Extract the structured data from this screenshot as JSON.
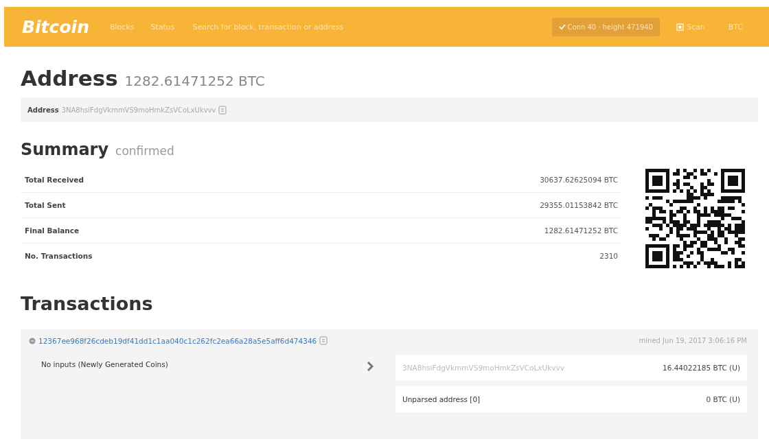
{
  "header": {
    "logo": "Bitcoin",
    "nav": [
      {
        "label": "Blocks"
      },
      {
        "label": "Status"
      }
    ],
    "search": {
      "placeholder": "Search for block, transaction or address"
    },
    "connection": "Conn 40 · height 471940",
    "scan": "Scan",
    "currency": "BTC"
  },
  "address": {
    "title": "Address",
    "balance": "1282.61471252 BTC",
    "label": "Address",
    "value": "3NA8hsiFdgVkmmVS9moHmkZsVCoLxUkvvv"
  },
  "summary": {
    "title": "Summary",
    "status": "confirmed",
    "rows": [
      {
        "label": "Total Received",
        "value": "30637.62625094 BTC"
      },
      {
        "label": "Total Sent",
        "value": "29355.01153842 BTC"
      },
      {
        "label": "Final Balance",
        "value": "1282.61471252 BTC"
      },
      {
        "label": "No. Transactions",
        "value": "2310"
      }
    ]
  },
  "transactions": {
    "title": "Transactions",
    "items": [
      {
        "hash": "12367ee968f26cdeb19df41dd1c1aa040c1c262fc2ea66a28a5e5aff6d474346",
        "time": "mined Jun 19, 2017 3:06:16 PM",
        "inputs": "No inputs (Newly Generated Coins)",
        "outputs": [
          {
            "address": "3NA8hsiFdgVkmmVS9moHmkZsVCoLxUkvvv",
            "amount": "16.44022185 BTC (U)",
            "muted": true
          },
          {
            "address": "Unparsed address [0]",
            "amount": "0 BTC (U)",
            "muted": false
          }
        ]
      }
    ]
  }
}
